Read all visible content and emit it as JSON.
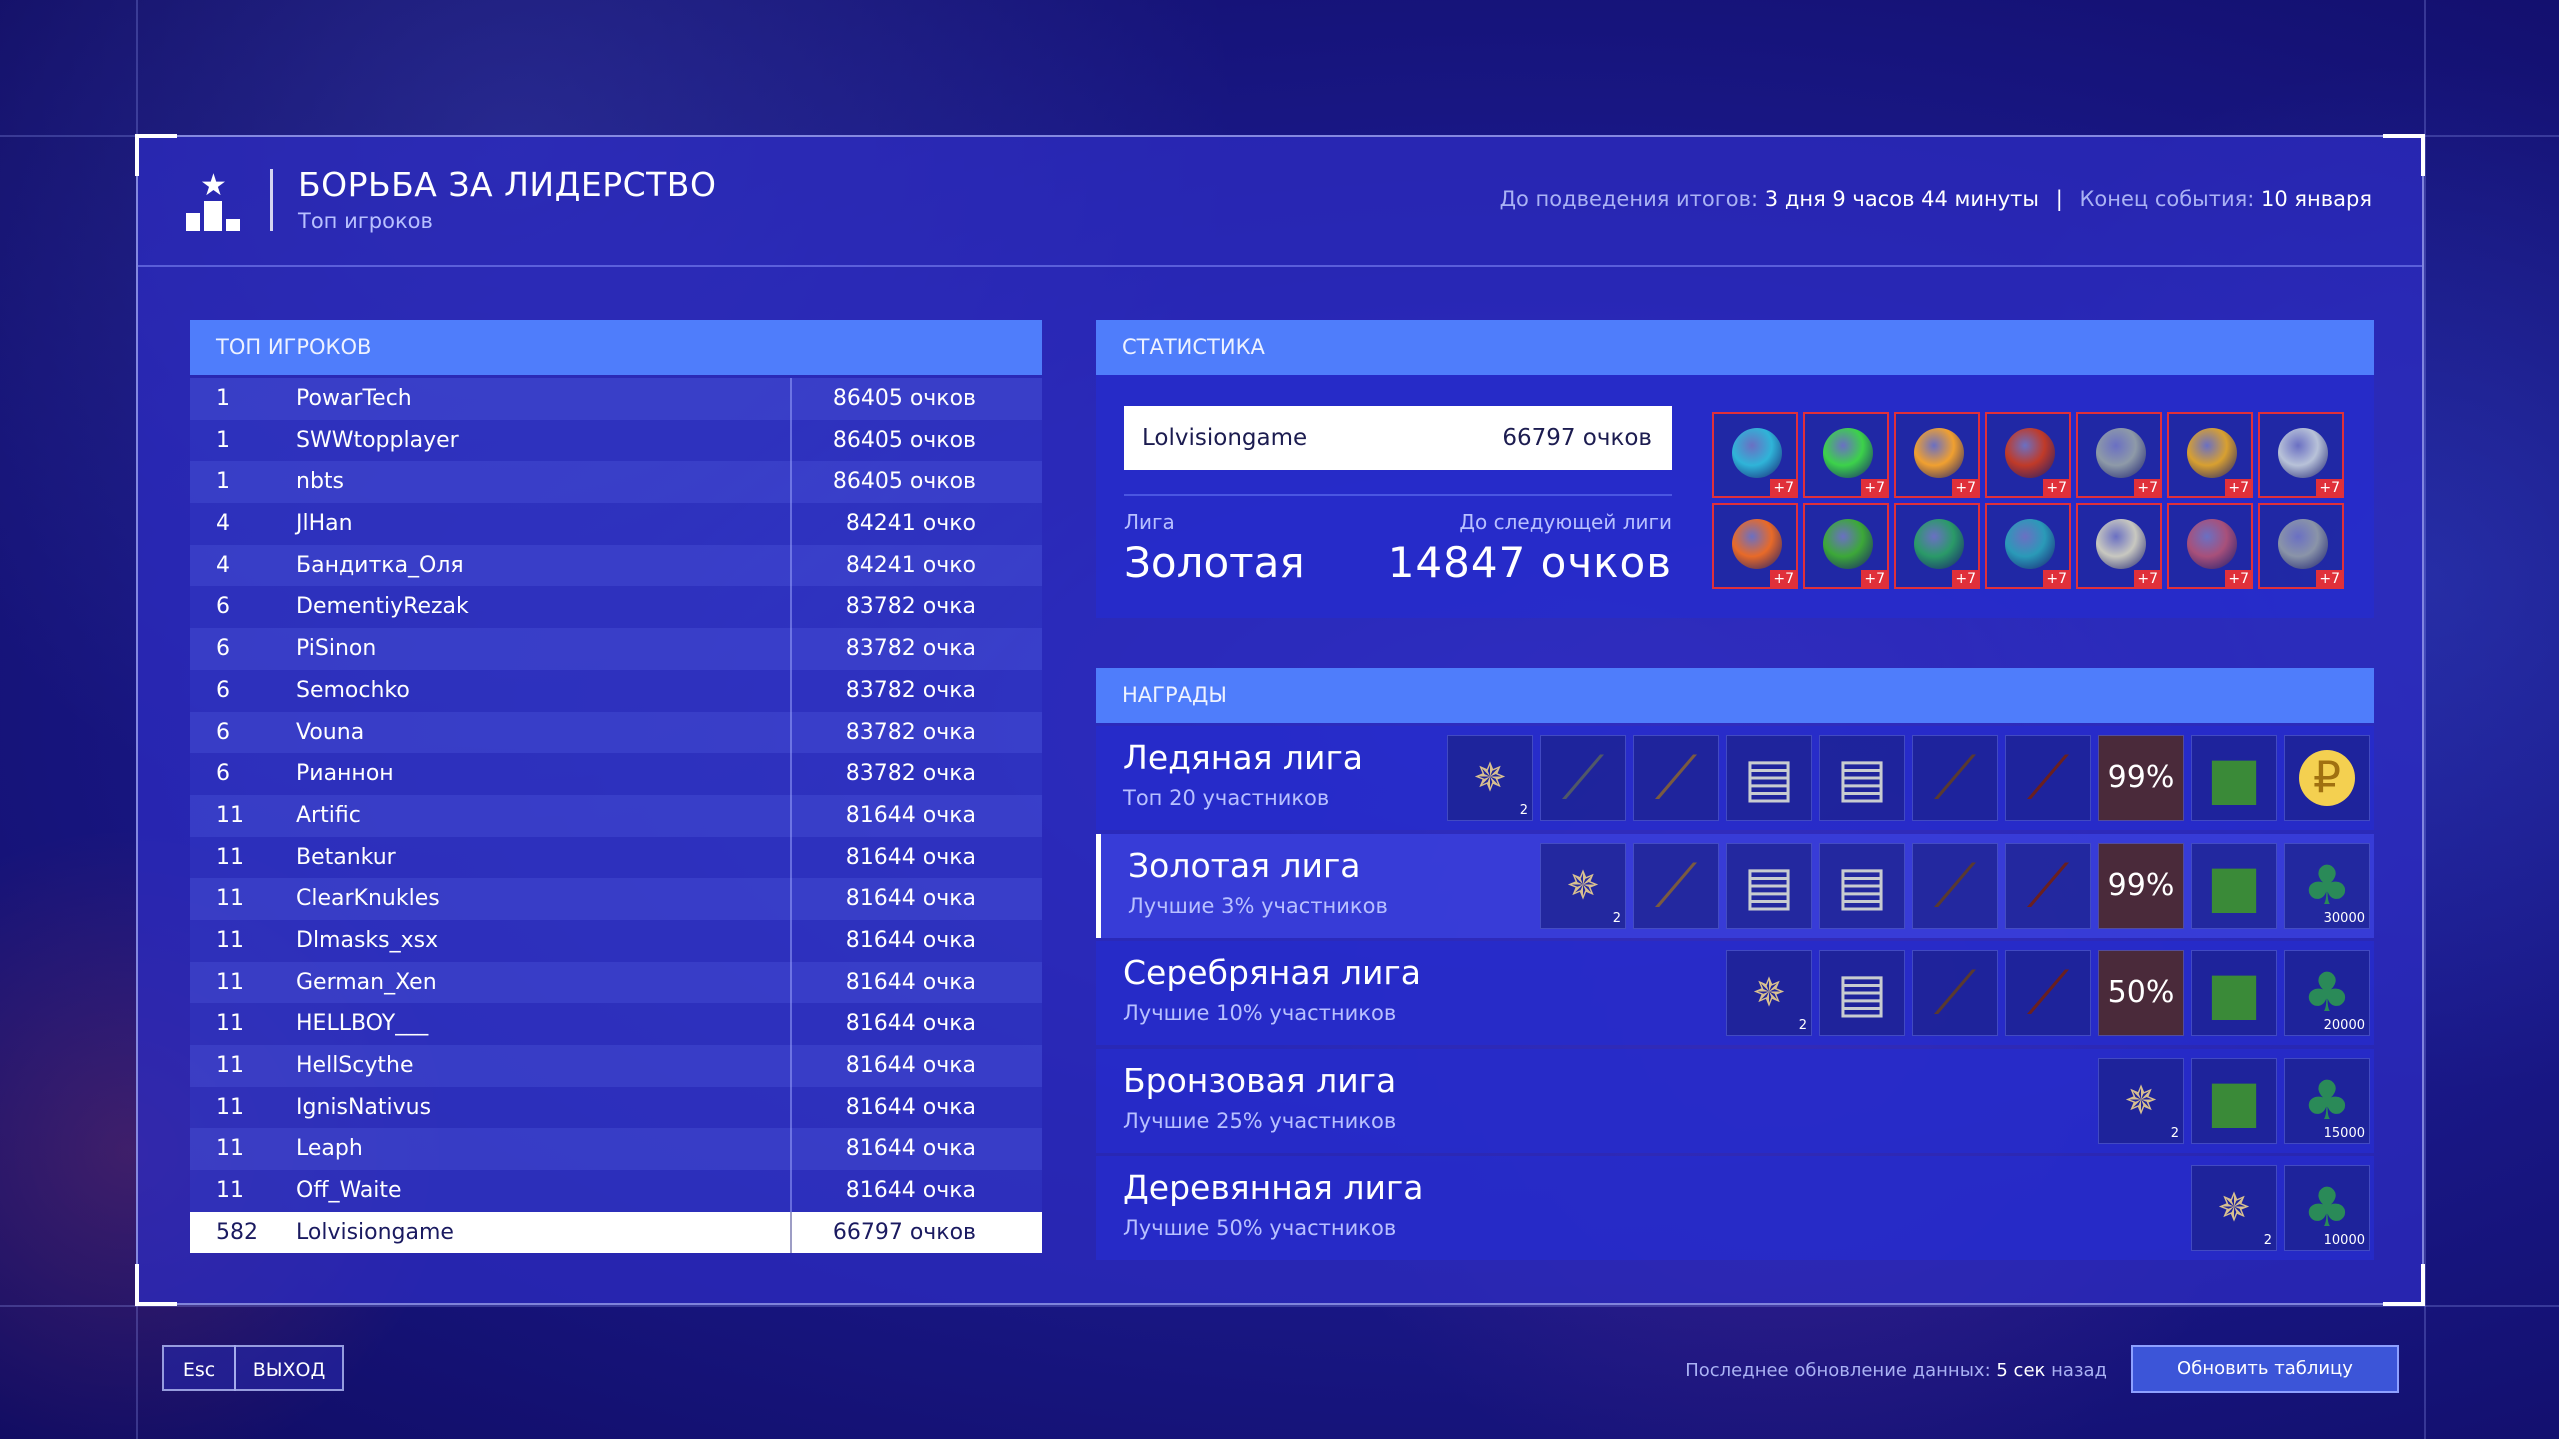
{
  "header": {
    "title": "БОРЬБА ЗА ЛИДЕРСТВО",
    "subtitle": "Топ игроков",
    "until_label": "До подведения итогов:",
    "until_value": "3 дня 9 часов 44 минуты",
    "separator": "|",
    "end_label": "Конец события:",
    "end_value": "10 января"
  },
  "leaderboard": {
    "heading": "ТОП ИГРОКОВ",
    "rows": [
      {
        "rank": "1",
        "name": "PowarTech",
        "score": "86405 очков"
      },
      {
        "rank": "1",
        "name": "SWWtopplayer",
        "score": "86405 очков"
      },
      {
        "rank": "1",
        "name": "nbts",
        "score": "86405 очков"
      },
      {
        "rank": "4",
        "name": "JlHan",
        "score": "84241 очко"
      },
      {
        "rank": "4",
        "name": "Бандитка_Оля",
        "score": "84241 очко"
      },
      {
        "rank": "6",
        "name": "DementiyRezak",
        "score": "83782 очка"
      },
      {
        "rank": "6",
        "name": "PiSinon",
        "score": "83782 очка"
      },
      {
        "rank": "6",
        "name": "Semochko",
        "score": "83782 очка"
      },
      {
        "rank": "6",
        "name": "Vouna",
        "score": "83782 очка"
      },
      {
        "rank": "6",
        "name": "Рианнон",
        "score": "83782 очка"
      },
      {
        "rank": "11",
        "name": "Artific",
        "score": "81644 очка"
      },
      {
        "rank": "11",
        "name": "Betankur",
        "score": "81644 очка"
      },
      {
        "rank": "11",
        "name": "ClearKnukles",
        "score": "81644 очка"
      },
      {
        "rank": "11",
        "name": "Dlmasks_xsx",
        "score": "81644 очка"
      },
      {
        "rank": "11",
        "name": "German_Xen",
        "score": "81644 очка"
      },
      {
        "rank": "11",
        "name": "HELLBOY___",
        "score": "81644 очка"
      },
      {
        "rank": "11",
        "name": "HellScythe",
        "score": "81644 очка"
      },
      {
        "rank": "11",
        "name": "IgnisNativus",
        "score": "81644 очка"
      },
      {
        "rank": "11",
        "name": "Leaph",
        "score": "81644 очка"
      },
      {
        "rank": "11",
        "name": "Off_Waite",
        "score": "81644 очка"
      }
    ],
    "me": {
      "rank": "582",
      "name": "Lolvisiongame",
      "score": "66797 очков"
    }
  },
  "stats": {
    "heading": "СТАТИСТИКА",
    "player": "Lolvisiongame",
    "score": "66797 очков",
    "league_label": "Лига",
    "league_value": "Золотая",
    "next_label": "До следующей лиги",
    "next_value": "14847 очков",
    "items": [
      {
        "icon": "blue-ornament-icon",
        "color": "#2fb4d8",
        "bonus": "+7"
      },
      {
        "icon": "green-lights-icon",
        "color": "#3cd24a",
        "bonus": "+7"
      },
      {
        "icon": "candles-icon",
        "color": "#f0a030",
        "bonus": "+7"
      },
      {
        "icon": "red-bow-icon",
        "color": "#c03a28",
        "bonus": "+7"
      },
      {
        "icon": "silver-ornament-icon",
        "color": "#8e9aa8",
        "bonus": "+7"
      },
      {
        "icon": "gold-pinecone-icon",
        "color": "#d8a030",
        "bonus": "+7"
      },
      {
        "icon": "snow-branch-icon",
        "color": "#b8c2d8",
        "bonus": "+7"
      },
      {
        "icon": "orange-garland-icon",
        "color": "#e86a28",
        "bonus": "+7"
      },
      {
        "icon": "green-tinsel-icon",
        "color": "#3ca838",
        "bonus": "+7"
      },
      {
        "icon": "green-garland-icon",
        "color": "#2a9a68",
        "bonus": "+7"
      },
      {
        "icon": "teal-ornament-icon",
        "color": "#2a9ab8",
        "bonus": "+7"
      },
      {
        "icon": "bell-icon",
        "color": "#c8c8c0",
        "bonus": "+7"
      },
      {
        "icon": "purple-ornament-icon",
        "color": "#a8507a",
        "bonus": "+7"
      },
      {
        "icon": "gray-cone-icon",
        "color": "#8a94a8",
        "bonus": "+7"
      }
    ]
  },
  "rewards": {
    "heading": "НАГРАДЫ",
    "leagues": [
      {
        "name": "Ледяная лига",
        "desc": "Топ 20 участников",
        "rewards": [
          {
            "icon": "snowflake-medal-icon",
            "count": "2"
          },
          {
            "icon": "sniper-rifle-icon"
          },
          {
            "icon": "shotgun-icon"
          },
          {
            "icon": "armor-plate-icon"
          },
          {
            "icon": "armor-plate-icon"
          },
          {
            "icon": "rifle-icon"
          },
          {
            "icon": "assault-rifle-icon"
          },
          {
            "icon": "percent-bonus-icon",
            "text": "99%"
          },
          {
            "icon": "gift-box-icon"
          },
          {
            "icon": "coin-icon"
          }
        ]
      },
      {
        "name": "Золотая лига",
        "desc": "Лучшие 3% участников",
        "rewards": [
          {
            "icon": "snowflake-medal-icon",
            "count": "2"
          },
          {
            "icon": "shotgun-icon"
          },
          {
            "icon": "armor-plate-icon"
          },
          {
            "icon": "armor-plate-icon"
          },
          {
            "icon": "rifle-icon"
          },
          {
            "icon": "assault-rifle-icon"
          },
          {
            "icon": "percent-bonus-icon",
            "text": "99%"
          },
          {
            "icon": "gift-box-icon"
          },
          {
            "icon": "pinecone-icon",
            "count": "30000"
          }
        ]
      },
      {
        "name": "Серебряная лига",
        "desc": "Лучшие 10% участников",
        "rewards": [
          {
            "icon": "snowflake-medal-icon",
            "count": "2"
          },
          {
            "icon": "armor-plate-icon"
          },
          {
            "icon": "rifle-icon"
          },
          {
            "icon": "assault-rifle-icon"
          },
          {
            "icon": "percent-bonus-icon",
            "text": "50%"
          },
          {
            "icon": "gift-box-icon"
          },
          {
            "icon": "pinecone-icon",
            "count": "20000"
          }
        ]
      },
      {
        "name": "Бронзовая лига",
        "desc": "Лучшие 25% участников",
        "rewards": [
          {
            "icon": "snowflake-medal-icon",
            "count": "2"
          },
          {
            "icon": "gift-box-icon"
          },
          {
            "icon": "pinecone-icon",
            "count": "15000"
          }
        ]
      },
      {
        "name": "Деревянная лига",
        "desc": "Лучшие 50% участников",
        "rewards": [
          {
            "icon": "snowflake-medal-icon",
            "count": "2"
          },
          {
            "icon": "pinecone-icon",
            "count": "10000"
          }
        ]
      }
    ]
  },
  "footer": {
    "esc_key": "Esc",
    "exit_label": "ВЫХОД",
    "update_label": "Последнее обновление данных:",
    "update_value": "5 сек",
    "update_suffix": "назад",
    "refresh_label": "Обновить таблицу"
  }
}
